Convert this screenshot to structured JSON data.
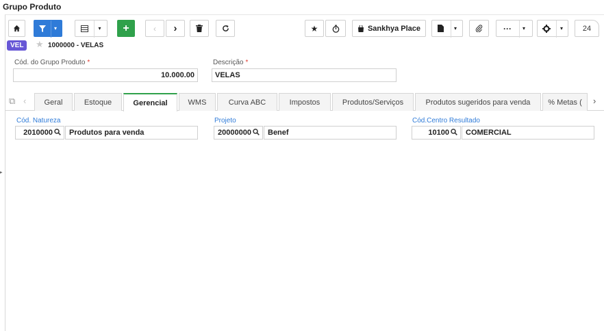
{
  "page_title": "Grupo Produto",
  "toolbar": {
    "home_icon": "home-icon",
    "filter_icon": "filter-icon",
    "grid_icon": "grid-icon",
    "add_label": "+",
    "prev_icon": "chevron-left-icon",
    "next_icon": "chevron-right-icon",
    "delete_icon": "trash-icon",
    "refresh_icon": "refresh-icon",
    "favorite_icon": "star-icon",
    "timer_icon": "stopwatch-icon",
    "sankhya_place_label": "Sankhya Place",
    "attach_icon": "paperclip-icon",
    "more_label": "···",
    "settings_icon": "gear-icon",
    "record_count": "24",
    "colors": {
      "primary": "#2f7bd8",
      "add": "#2fa14b"
    }
  },
  "record": {
    "badge": "VEL",
    "badge_color": "#6757d6",
    "title": "1000000 - VELAS"
  },
  "form": {
    "cod_grupo_label": "Cód. do Grupo Produto",
    "cod_grupo_value": "10.000.00",
    "descricao_label": "Descrição",
    "descricao_value": "VELAS",
    "required_mark": "*"
  },
  "tabs": [
    {
      "label": "Geral"
    },
    {
      "label": "Estoque"
    },
    {
      "label": "Gerencial",
      "active": true
    },
    {
      "label": "WMS"
    },
    {
      "label": "Curva ABC"
    },
    {
      "label": "Impostos"
    },
    {
      "label": "Produtos/Serviços"
    },
    {
      "label": "Produtos sugeridos para venda"
    },
    {
      "label": "% Metas ("
    }
  ],
  "gerencial": {
    "natureza_label": "Cód. Natureza",
    "natureza_code": "2010000",
    "natureza_desc": "Produtos para venda",
    "projeto_label": "Projeto",
    "projeto_code": "20000000",
    "projeto_desc": "Benef",
    "centro_label": "Cód.Centro Resultado",
    "centro_code": "10100",
    "centro_desc": "COMERCIAL"
  }
}
